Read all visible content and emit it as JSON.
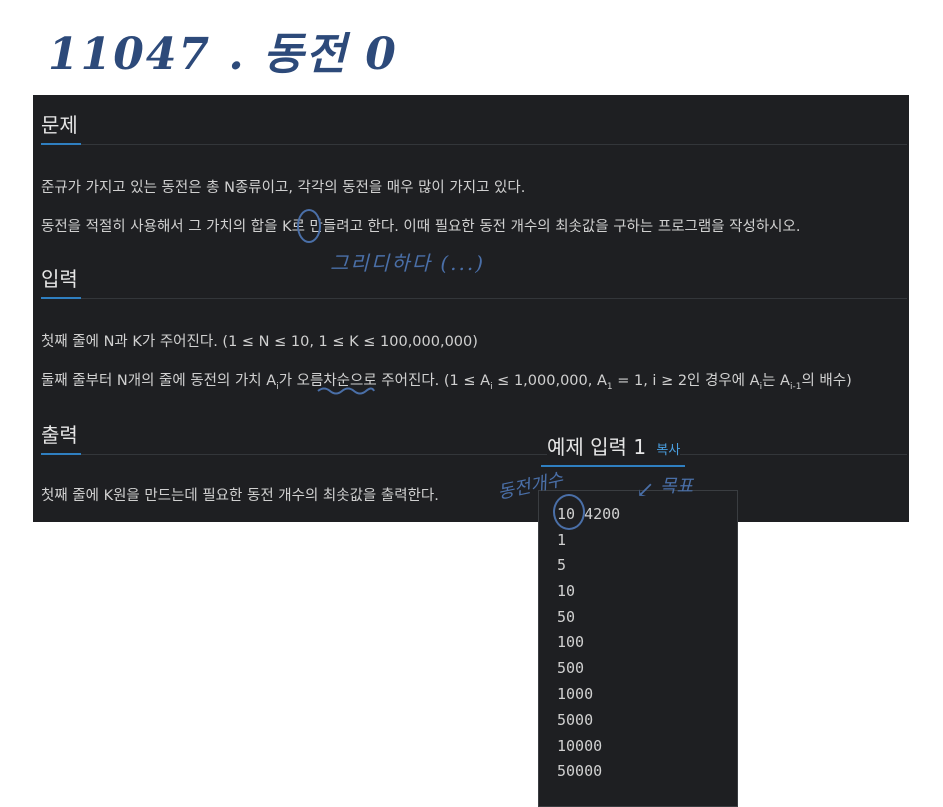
{
  "page_title_note": "11047 . 동전 0",
  "problem": {
    "heading": "문제",
    "para1": "준규가 가지고 있는 동전은 총 N종류이고, 각각의 동전을 매우 많이 가지고 있다.",
    "para2": "동전을 적절히 사용해서 그 가치의 합을 K로 만들려고 한다. 이때 필요한 동전 개수의 최솟값을 구하는 프로그램을 작성하시오."
  },
  "input": {
    "heading": "입력",
    "para1": "첫째 줄에 N과 K가 주어진다. (1 ≤ N ≤ 10, 1 ≤ K ≤ 100,000,000)",
    "para2_a": "둘째 줄부터 N개의 줄에 동전의 가치 A",
    "para2_sub1": "i",
    "para2_b": "가 오름차순으로 주어진다. (1 ≤ A",
    "para2_sub2": "i",
    "para2_c": " ≤ 1,000,000, A",
    "para2_sub3": "1",
    "para2_d": " = 1, i ≥ 2인 경우에 A",
    "para2_sub4": "i",
    "para2_e": "는 A",
    "para2_sub5": "i-1",
    "para2_f": "의 배수)"
  },
  "output": {
    "heading": "출력",
    "para1": "첫째 줄에 K원을 만드는데 필요한 동전 개수의 최솟값을 출력한다."
  },
  "sample": {
    "title": "예제 입력 1",
    "copy_label": "복사",
    "lines": [
      "10 4200",
      "1",
      "5",
      "10",
      "50",
      "100",
      "500",
      "1000",
      "5000",
      "10000",
      "50000"
    ]
  },
  "annotations": {
    "greedy_note": "그리디하다 (...)",
    "coin_count_note": "동전개수",
    "target_note": "목표",
    "arrow": "↙"
  }
}
